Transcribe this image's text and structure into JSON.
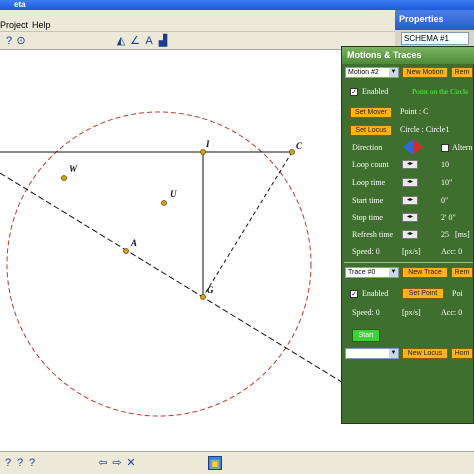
{
  "window": {
    "title": "eta"
  },
  "menu": {
    "project": "Project",
    "help": "Help"
  },
  "toolbar": {
    "pen_glyph": "A"
  },
  "properties": {
    "title": "Properties",
    "schema": "SCHEMA #1"
  },
  "motions": {
    "title": "Motions & Traces",
    "motion_select": "Motion #2",
    "new_motion": "New Motion",
    "remove": "Rem",
    "enabled": "Enabled",
    "point_on_circle": "Point on the Circle",
    "set_mover": "Set Mover",
    "point_label": "Point : C",
    "set_locus": "Set Locus",
    "circle_label": "Circle : Circle1",
    "direction": "Direction",
    "alternate": "Altern",
    "loop_count_label": "Loop count",
    "loop_count": "10",
    "loop_time_label": "Loop time",
    "loop_time": "10\"",
    "start_time_label": "Start time",
    "start_time": "0\"",
    "stop_time_label": "Stop time",
    "stop_time": "2' 0\"",
    "refresh_label": "Refresh time",
    "refresh": "25",
    "refresh_unit": "[ms]",
    "speed_label": "Speed: 0",
    "speed_unit": "[px/s]",
    "acc_label": "Acc: 0"
  },
  "traces": {
    "trace_select": "Trace #0",
    "new_trace": "New Trace",
    "remove": "Rem",
    "enabled": "Enabled",
    "set_point": "Set Point",
    "point_label": "Poi",
    "speed_label": "Speed: 0",
    "speed_unit": "[px/s]",
    "acc_label": "Acc: 0",
    "start": "Start",
    "new_locus": "New Locus",
    "home": "Hom"
  },
  "geometry": {
    "labels": {
      "I": "I",
      "C": "C",
      "W": "W",
      "U": "U",
      "A": "A",
      "G": "G"
    }
  },
  "colors": {
    "circle": "#c0392b",
    "panel": "#3f6f2e",
    "point": "#d4a017"
  }
}
